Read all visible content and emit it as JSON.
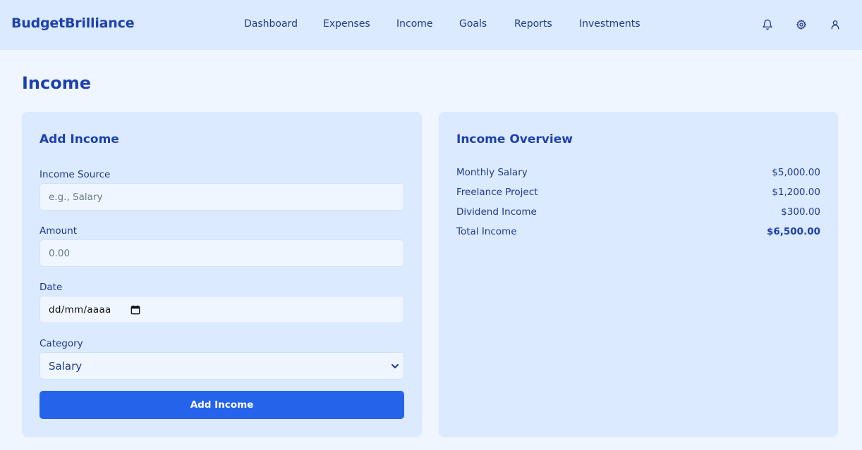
{
  "app": {
    "brand": "BudgetBrilliance"
  },
  "nav": {
    "items": [
      {
        "label": "Dashboard"
      },
      {
        "label": "Expenses"
      },
      {
        "label": "Income"
      },
      {
        "label": "Goals"
      },
      {
        "label": "Reports"
      },
      {
        "label": "Investments"
      }
    ]
  },
  "header_icons": [
    "bell-icon",
    "gear-icon",
    "user-icon"
  ],
  "page": {
    "title": "Income"
  },
  "add_income": {
    "title": "Add Income",
    "source": {
      "label": "Income Source",
      "placeholder": "e.g., Salary",
      "value": ""
    },
    "amount": {
      "label": "Amount",
      "placeholder": "0.00",
      "value": ""
    },
    "date": {
      "label": "Date",
      "value": "dd/mm/aaaa"
    },
    "category": {
      "label": "Category",
      "selected": "Salary"
    },
    "submit_label": "Add Income"
  },
  "overview": {
    "title": "Income Overview",
    "rows": [
      {
        "label": "Monthly Salary",
        "amount": "$5,000.00"
      },
      {
        "label": "Freelance Project",
        "amount": "$1,200.00"
      },
      {
        "label": "Dividend Income",
        "amount": "$300.00"
      }
    ],
    "total": {
      "label": "Total Income",
      "amount": "$6,500.00"
    }
  },
  "colors": {
    "accent": "#2563eb",
    "header_bg": "#dbeafe",
    "page_bg": "#eff6ff",
    "text": "#1e3a8a"
  }
}
